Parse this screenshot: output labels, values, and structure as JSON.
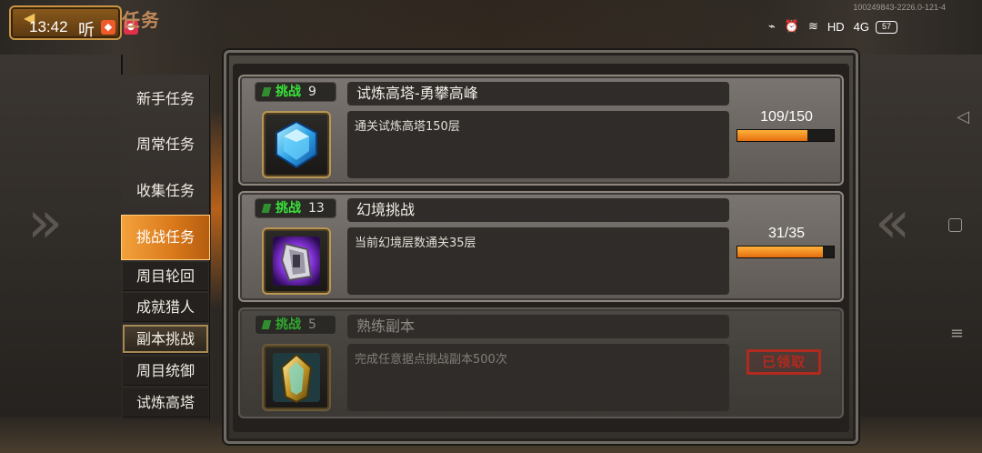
{
  "status_bar": {
    "time": "13:42",
    "ting": "听",
    "build_code": "100249843-2226.0-121-4",
    "network": "HD",
    "signal": "4G",
    "battery": "57"
  },
  "screen": {
    "title": "任务"
  },
  "side_menu": {
    "items": [
      {
        "label": "新手任务"
      },
      {
        "label": "周常任务"
      },
      {
        "label": "收集任务"
      },
      {
        "label": "挑战任务"
      }
    ],
    "sub_items": [
      {
        "label": "周目轮回"
      },
      {
        "label": "成就猎人"
      },
      {
        "label": "副本挑战"
      },
      {
        "label": "周目统御"
      },
      {
        "label": "试炼高塔"
      }
    ],
    "active_index": 3,
    "selected_sub_index": 2
  },
  "tasks": [
    {
      "type_label": "挑战",
      "number": "9",
      "title": "试炼高塔-勇攀高峰",
      "description": "通关试炼高塔150层",
      "progress_text": "109/150",
      "progress_fraction": 0.7267,
      "icon": "blue-gem-icon",
      "status": "in-progress"
    },
    {
      "type_label": "挑战",
      "number": "13",
      "title": "幻境挑战",
      "description": "当前幻境层数通关35层",
      "progress_text": "31/35",
      "progress_fraction": 0.8857,
      "icon": "purple-crystal-icon",
      "status": "in-progress"
    },
    {
      "type_label": "挑战",
      "number": "5",
      "title": "熟练副本",
      "description": "完成任意据点挑战副本500次",
      "claimed_label": "已领取",
      "icon": "gold-shield-crystal-icon",
      "status": "claimed"
    }
  ],
  "colors": {
    "accent_orange": "#e48a1e",
    "challenge_green": "#39e33a",
    "claimed_red": "#b02a1f"
  }
}
